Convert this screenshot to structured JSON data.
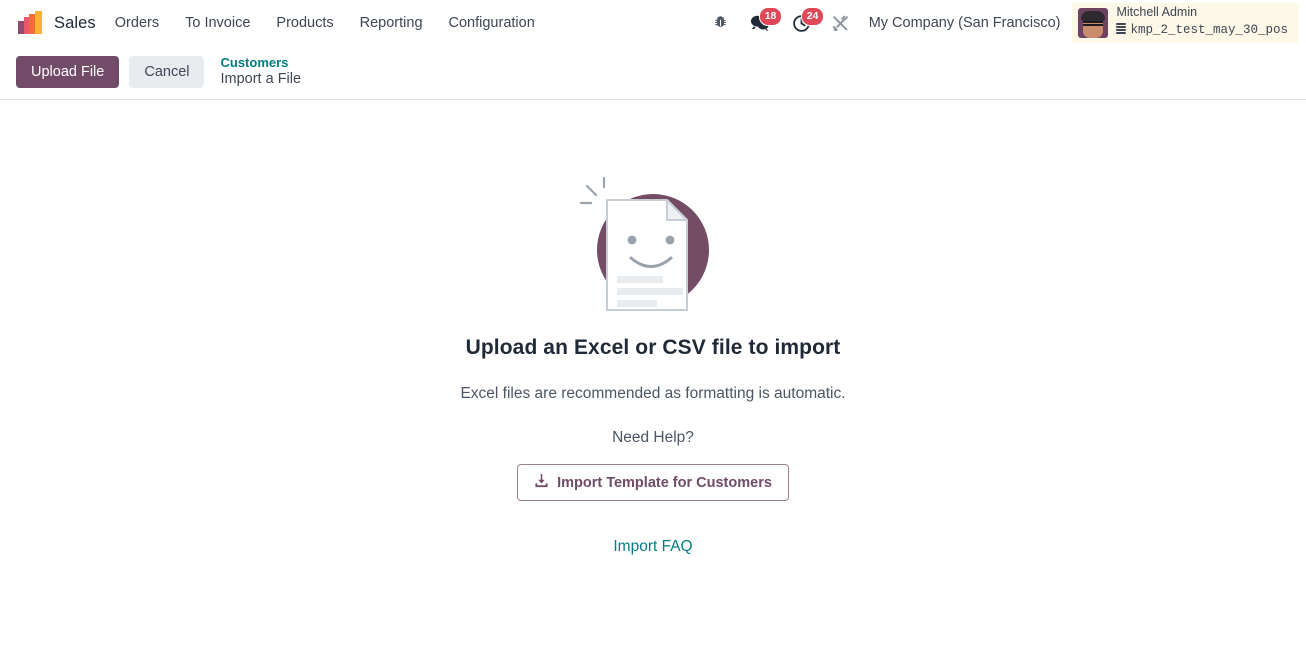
{
  "navbar": {
    "brand": {
      "label": "Sales",
      "icon": "sales-app-logo-icon"
    },
    "menu_items": [
      {
        "label": "Orders"
      },
      {
        "label": "To Invoice"
      },
      {
        "label": "Products"
      },
      {
        "label": "Reporting"
      },
      {
        "label": "Configuration"
      }
    ],
    "systray": {
      "debug_icon": "bug-icon",
      "messages": {
        "icon": "messages-icon",
        "count": "18"
      },
      "activities": {
        "icon": "clock-activity-icon",
        "count": "24"
      },
      "tools_icon": "tools-icon",
      "company": "My Company (San Francisco)"
    },
    "user": {
      "name": "Mitchell Admin",
      "database": "kmp_2_test_may_30_pos",
      "database_icon": "database-icon",
      "avatar": "user-avatar"
    }
  },
  "control_panel": {
    "upload_label": "Upload File",
    "cancel_label": "Cancel",
    "breadcrumb_parent": "Customers",
    "breadcrumb_current": "Import a File"
  },
  "main": {
    "illustration": "file-upload-illustration",
    "headline": "Upload an Excel or CSV file to import",
    "subtext": "Excel files are recommended as formatting is automatic.",
    "need_help": "Need Help?",
    "template_button": "Import Template for Customers",
    "template_icon": "download-icon",
    "faq_link": "Import FAQ"
  },
  "colors": {
    "primary": "#714b67",
    "link": "#017e84",
    "badge": "#e0485a",
    "user_bg": "#fdf8e8"
  }
}
